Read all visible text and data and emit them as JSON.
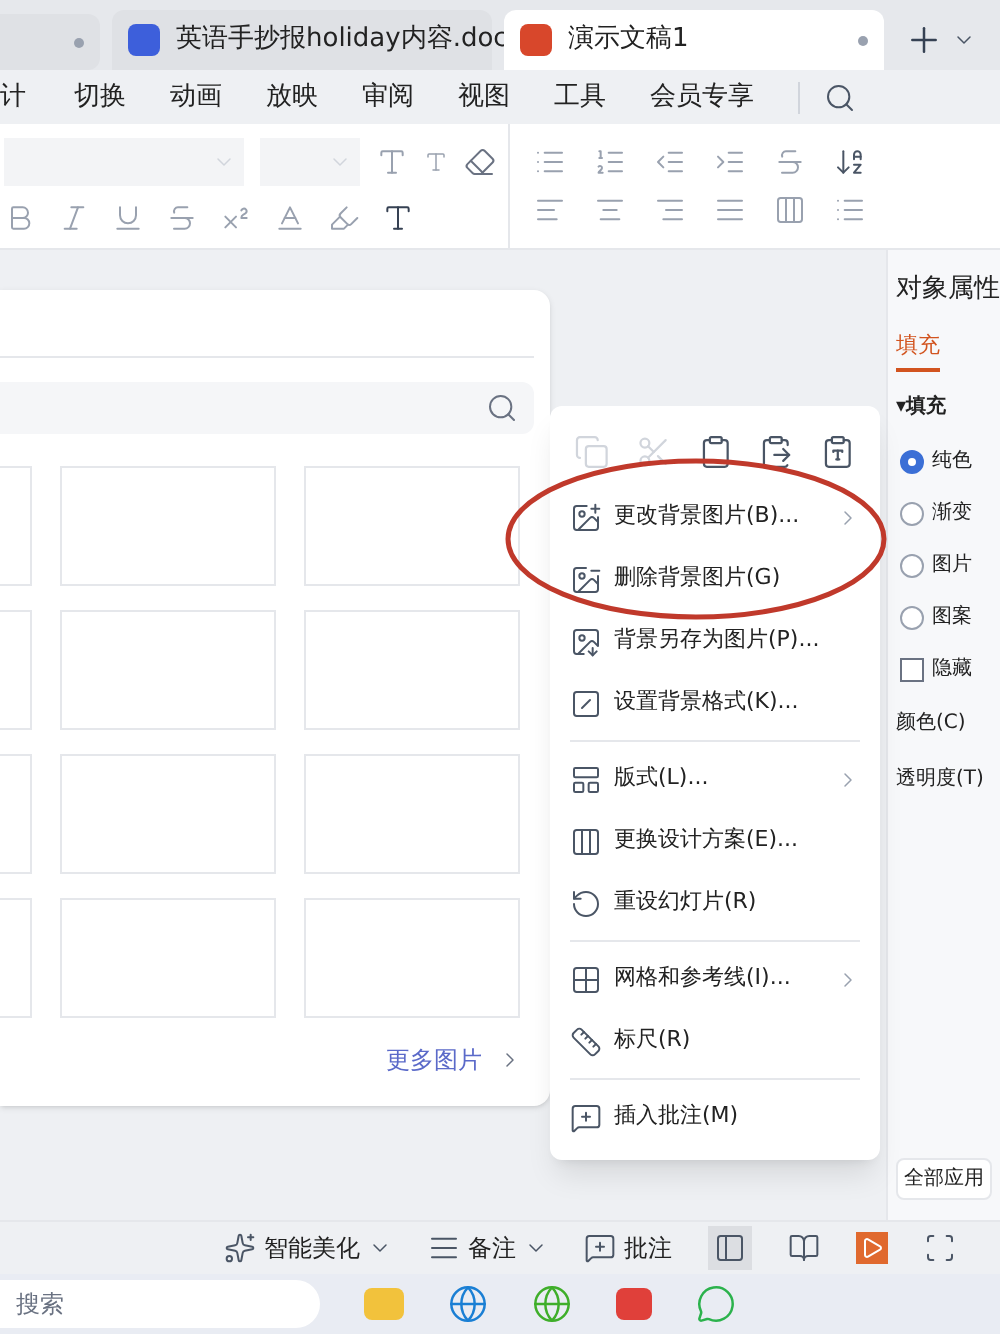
{
  "tabs": [
    {
      "label": "英语手抄报holiday内容.doc",
      "kind": "word",
      "selected": false
    },
    {
      "label": "演示文稿1",
      "kind": "slides",
      "selected": true
    }
  ],
  "menu": [
    {
      "label": "计"
    },
    {
      "label": "切换"
    },
    {
      "label": "动画"
    },
    {
      "label": "放映"
    },
    {
      "label": "审阅"
    },
    {
      "label": "视图"
    },
    {
      "label": "工具"
    },
    {
      "label": "会员专享"
    }
  ],
  "dialog": {
    "more_link": "更多图片"
  },
  "context_menu": {
    "items": [
      {
        "kind": "item",
        "label": "更改背景图片(B)...",
        "submenu": true
      },
      {
        "kind": "item",
        "label": "删除背景图片(G)",
        "submenu": false
      },
      {
        "kind": "item",
        "label": "背景另存为图片(P)...",
        "submenu": false
      },
      {
        "kind": "item",
        "label": "设置背景格式(K)...",
        "submenu": false
      },
      {
        "kind": "divider"
      },
      {
        "kind": "item",
        "label": "版式(L)...",
        "submenu": true
      },
      {
        "kind": "item",
        "label": "更换设计方案(E)...",
        "submenu": false
      },
      {
        "kind": "item",
        "label": "重设幻灯片(R)",
        "submenu": false
      },
      {
        "kind": "divider"
      },
      {
        "kind": "item",
        "label": "网格和参考线(I)...",
        "submenu": true
      },
      {
        "kind": "item",
        "label": "标尺(R)",
        "submenu": false
      },
      {
        "kind": "divider"
      },
      {
        "kind": "item",
        "label": "插入批注(M)",
        "submenu": false
      }
    ]
  },
  "panel": {
    "title": "对象属性",
    "tab": {
      "label": "填充",
      "selected": true
    },
    "section": "▾填充",
    "options": [
      {
        "label": "纯色",
        "selected": true
      },
      {
        "label": "渐变",
        "selected": false
      },
      {
        "label": "图片",
        "selected": false
      },
      {
        "label": "图案",
        "selected": false
      }
    ],
    "hide": {
      "label": "隐藏",
      "checked": false
    },
    "fields": [
      {
        "label": "颜色(C)"
      },
      {
        "label": "透明度(T)"
      }
    ],
    "apply_button": "全部应用"
  },
  "status_bar": [
    {
      "label": "智能美化",
      "dropdown": true
    },
    {
      "label": "备注",
      "dropdown": true
    },
    {
      "label": "批注",
      "dropdown": false
    }
  ],
  "taskbar": {
    "search_placeholder": "搜索"
  }
}
